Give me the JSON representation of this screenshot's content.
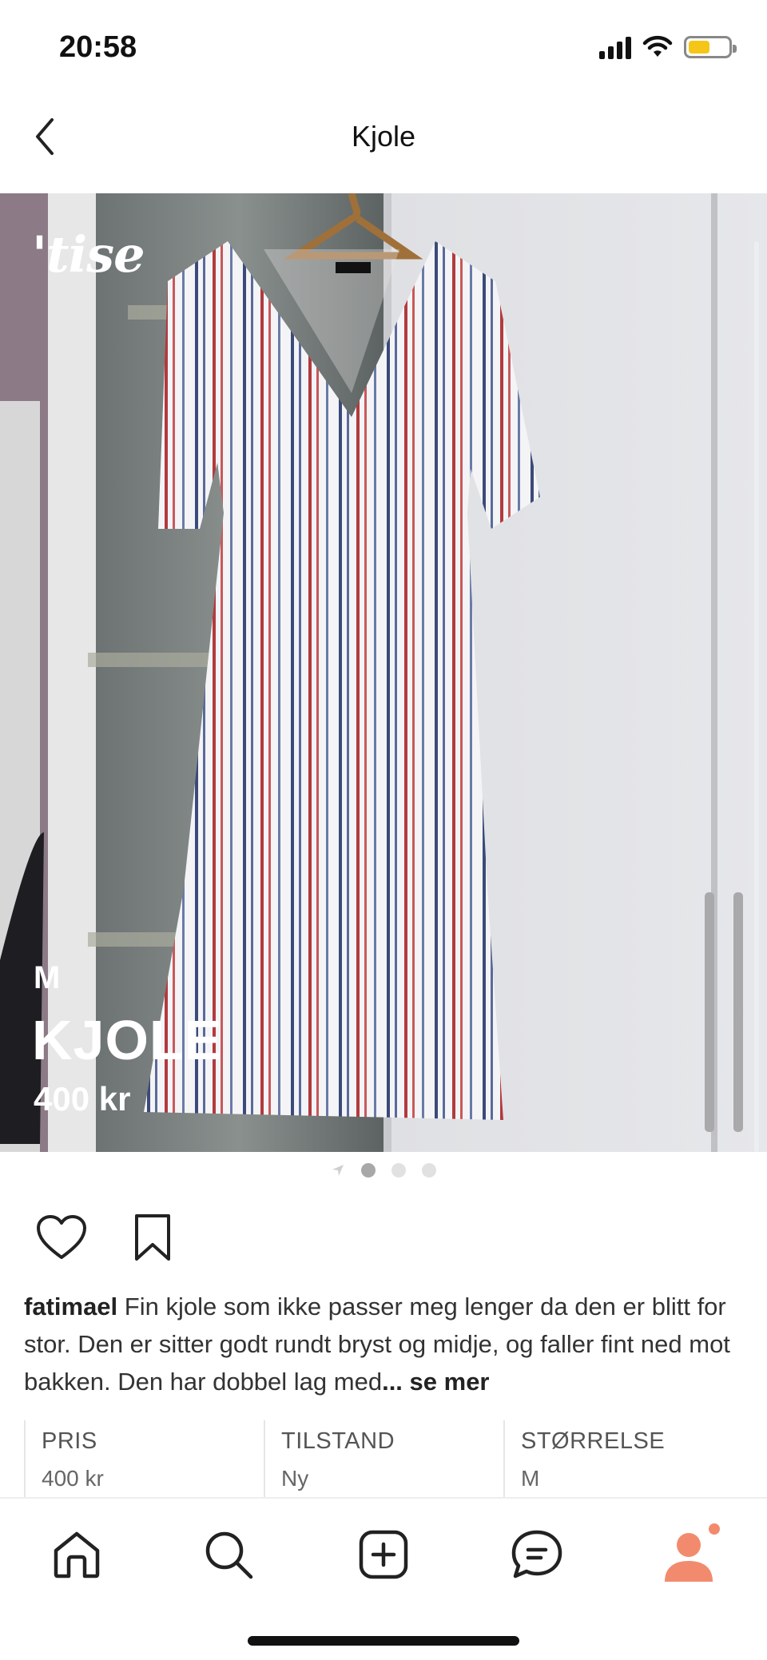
{
  "status_bar": {
    "time": "20:58"
  },
  "header": {
    "title": "Kjole"
  },
  "image": {
    "logo_text": "'tise",
    "overlay_size": "M",
    "overlay_title": "KJOLE",
    "overlay_price": "400 kr",
    "pager": {
      "total": 3,
      "active_index": 0
    }
  },
  "post": {
    "username": "fatimael",
    "text": " Fin kjole som ikke passer meg lenger da den er blitt for stor. Den er sitter godt rundt bryst og midje, og faller fint ned mot bakken. Den har dobbel lag med",
    "more_label": "... se mer"
  },
  "info": {
    "price_label": "PRIS",
    "price_value": "400 kr",
    "condition_label": "TILSTAND",
    "condition_value": "Ny",
    "size_label": "STØRRELSE",
    "size_value": "M"
  },
  "nav": {
    "items": [
      "home-icon",
      "search-icon",
      "add-icon",
      "messages-icon",
      "profile-icon"
    ],
    "accent_color": "#f28b6e"
  },
  "colors": {
    "battery": "#f5c518",
    "accent": "#f28b6e"
  }
}
